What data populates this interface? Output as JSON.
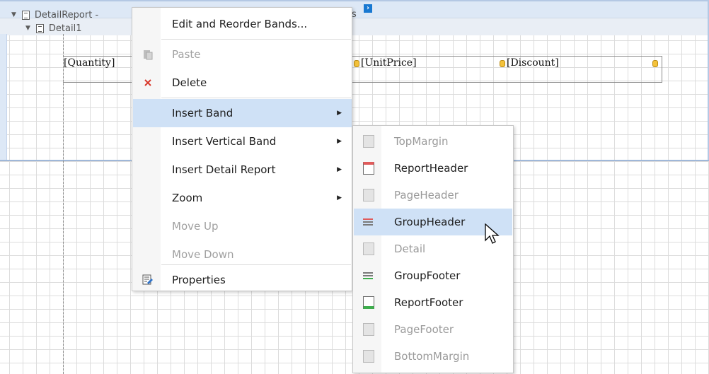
{
  "report_designer": {
    "band_header": {
      "detail_report_label": "DetailReport - ",
      "header_tail": "s",
      "detail_label": "Detail1"
    },
    "fields": {
      "quantity": "[Quantity]",
      "unit_price": "[UnitPrice]",
      "discount": "[Discount]"
    }
  },
  "context_menu": {
    "items": [
      {
        "label": "Edit and Reorder Bands...",
        "icon": "none",
        "enabled": true
      },
      {
        "label": "Paste",
        "icon": "paste-icon",
        "enabled": false
      },
      {
        "label": "Delete",
        "icon": "delete-icon",
        "enabled": true
      },
      {
        "label": "Insert Band",
        "icon": "none",
        "enabled": true,
        "submenu": true,
        "highlighted": true
      },
      {
        "label": "Insert Vertical Band",
        "icon": "none",
        "enabled": true,
        "submenu": true
      },
      {
        "label": "Insert Detail Report",
        "icon": "none",
        "enabled": true,
        "submenu": true
      },
      {
        "label": "Zoom",
        "icon": "none",
        "enabled": true,
        "submenu": true
      },
      {
        "label": "Move Up",
        "icon": "none",
        "enabled": false
      },
      {
        "label": "Move Down",
        "icon": "none",
        "enabled": false
      },
      {
        "label": "Properties",
        "icon": "properties-icon",
        "enabled": true
      }
    ]
  },
  "insert_band_submenu": {
    "items": [
      {
        "label": "TopMargin",
        "icon": "top-margin-band-icon",
        "enabled": false
      },
      {
        "label": "ReportHeader",
        "icon": "report-header-band-icon",
        "enabled": true
      },
      {
        "label": "PageHeader",
        "icon": "page-header-band-icon",
        "enabled": false
      },
      {
        "label": "GroupHeader",
        "icon": "group-header-band-icon",
        "enabled": true,
        "highlighted": true
      },
      {
        "label": "Detail",
        "icon": "detail-band-icon",
        "enabled": false
      },
      {
        "label": "GroupFooter",
        "icon": "group-footer-band-icon",
        "enabled": true
      },
      {
        "label": "ReportFooter",
        "icon": "report-footer-band-icon",
        "enabled": true
      },
      {
        "label": "PageFooter",
        "icon": "page-footer-band-icon",
        "enabled": false
      },
      {
        "label": "BottomMargin",
        "icon": "bottom-margin-band-icon",
        "enabled": false
      }
    ]
  },
  "colors": {
    "band_header_bg": "#dde8f6",
    "menu_highlight": "#cfe1f6",
    "delete_red": "#d9382b",
    "disabled_text": "#a0a0a0"
  }
}
